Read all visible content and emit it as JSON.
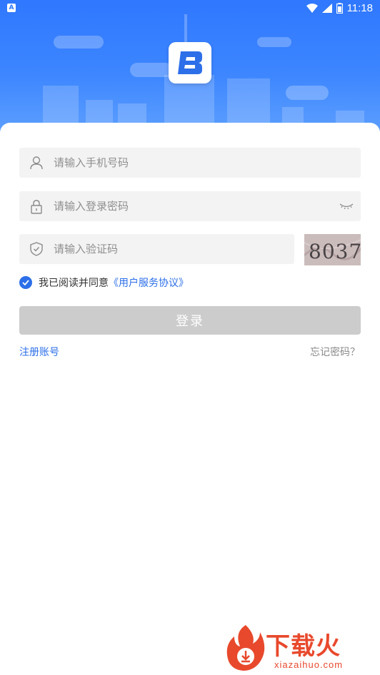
{
  "status_bar": {
    "notif_glyph": "A",
    "time": "11:18",
    "icons": [
      "wifi-icon",
      "signal-icon",
      "battery-icon"
    ]
  },
  "form": {
    "phone_placeholder": "请输入手机号码",
    "password_placeholder": "请输入登录密码",
    "code_placeholder": "请输入验证码",
    "captcha_text": "8037"
  },
  "agreement": {
    "prefix": "我已阅读并同意",
    "link": "《用户服务协议》",
    "checked": true
  },
  "login_label": "登录",
  "register_label": "注册账号",
  "forgot_label": "忘记密码？",
  "watermark": {
    "text": "下载火",
    "url": "xiazaihuo.com"
  },
  "colors": {
    "header_blue": "#2f78ff",
    "accent": "#2c6fe8",
    "button_disabled": "#cccccc",
    "watermark": "#e8492c"
  }
}
